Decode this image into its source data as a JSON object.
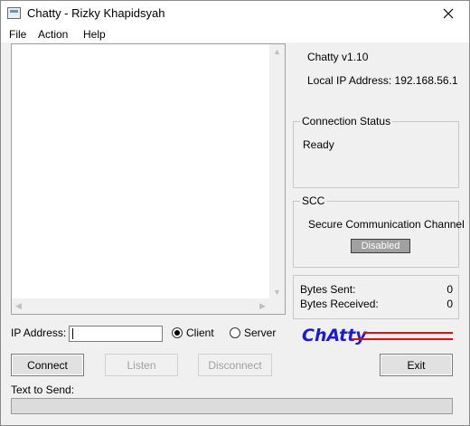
{
  "window": {
    "title": "Chatty - Rizky Khapidsyah"
  },
  "menu": {
    "items": [
      "File",
      "Action",
      "Help"
    ]
  },
  "info": {
    "version": "Chatty v1.10",
    "local_ip_label": "Local IP Address:",
    "local_ip_value": "192.168.56.1"
  },
  "connection_status": {
    "title": "Connection Status",
    "value": "Ready"
  },
  "scc": {
    "title": "SCC",
    "description": "Secure Communication Channel",
    "status": "Disabled"
  },
  "stats": {
    "bytes_sent_label": "Bytes Sent:",
    "bytes_sent": "0",
    "bytes_received_label": "Bytes Received:",
    "bytes_received": "0"
  },
  "ip": {
    "label": "IP Address:",
    "value": ""
  },
  "mode": {
    "client_label": "Client",
    "server_label": "Server",
    "selected": "Client"
  },
  "logo": {
    "text": "ChAtty",
    "text_color": "#1a1ad6",
    "line_color": "#e01010"
  },
  "buttons": {
    "connect": "Connect",
    "listen": "Listen",
    "disconnect": "Disconnect",
    "exit": "Exit"
  },
  "send": {
    "label": "Text to Send:",
    "value": ""
  }
}
